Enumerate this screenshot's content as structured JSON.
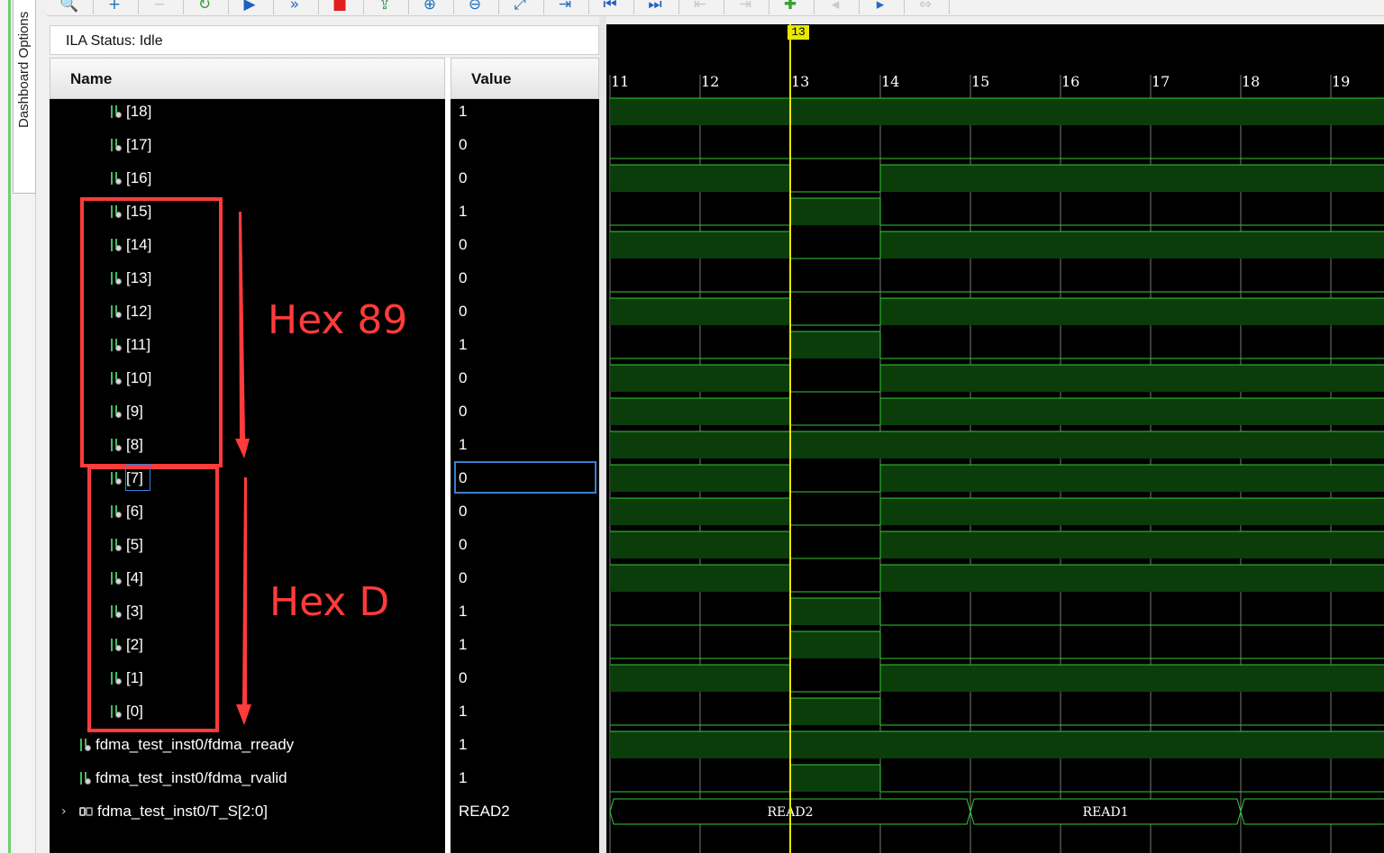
{
  "dashboard": {
    "tab_label": "Dashboard Options"
  },
  "toolbar": {
    "buttons": [
      {
        "name": "zoom-icon",
        "glyph": "🔍",
        "color": "#1f6fbf"
      },
      {
        "name": "add-probe-icon",
        "glyph": "+",
        "color": "#1f6fbf"
      },
      {
        "name": "remove-probe-icon",
        "glyph": "−",
        "color": "#c9c9c9"
      },
      {
        "name": "auto-trigger-icon",
        "glyph": "↻",
        "color": "#2fa32f"
      },
      {
        "name": "run-trigger-icon",
        "glyph": "▶",
        "color": "#1f5fbf"
      },
      {
        "name": "trigger-immediate-icon",
        "glyph": "»",
        "color": "#1f5fbf"
      },
      {
        "name": "stop-trigger-icon",
        "glyph": "■",
        "color": "#e02020"
      },
      {
        "name": "export-icon",
        "glyph": "⇪",
        "color": "#2f8f4f"
      },
      {
        "name": "zoom-in-icon",
        "glyph": "⊕",
        "color": "#1f6fbf"
      },
      {
        "name": "zoom-out-icon",
        "glyph": "⊖",
        "color": "#1f6fbf"
      },
      {
        "name": "zoom-fit-icon",
        "glyph": "⤢",
        "color": "#1f6fbf"
      },
      {
        "name": "goto-cursor-icon",
        "glyph": "⇥",
        "color": "#1f6fbf"
      },
      {
        "name": "goto-start-icon",
        "glyph": "⏮",
        "color": "#1f5fbf"
      },
      {
        "name": "goto-end-icon",
        "glyph": "⏭",
        "color": "#1f5fbf"
      },
      {
        "name": "prev-transition-icon",
        "glyph": "⇤",
        "color": "#c9c9c9"
      },
      {
        "name": "next-transition-icon",
        "glyph": "⇥",
        "color": "#c9c9c9"
      },
      {
        "name": "add-marker-icon",
        "glyph": "✚",
        "color": "#2fa32f"
      },
      {
        "name": "prev-marker-icon",
        "glyph": "◂",
        "color": "#c9c9c9"
      },
      {
        "name": "next-marker-icon",
        "glyph": "▸",
        "color": "#1f6fbf"
      },
      {
        "name": "swap-cursors-icon",
        "glyph": "⇔",
        "color": "#c9c9c9"
      }
    ]
  },
  "status": {
    "text": "ILA Status:  Idle"
  },
  "columns": {
    "name": "Name",
    "value": "Value"
  },
  "signals": [
    {
      "label": "[18]",
      "value": "1",
      "kind": "bit",
      "wave": [
        1,
        1,
        1,
        1,
        1,
        1,
        1,
        1,
        1
      ]
    },
    {
      "label": "[17]",
      "value": "0",
      "kind": "bit",
      "wave": [
        0,
        0,
        0,
        0,
        0,
        0,
        0,
        0,
        0
      ]
    },
    {
      "label": "[16]",
      "value": "0",
      "kind": "bit",
      "wave": [
        1,
        1,
        0,
        1,
        1,
        1,
        1,
        1,
        1
      ]
    },
    {
      "label": "[15]",
      "value": "1",
      "kind": "bit",
      "wave": [
        0,
        0,
        1,
        0,
        0,
        0,
        0,
        0,
        0
      ]
    },
    {
      "label": "[14]",
      "value": "0",
      "kind": "bit",
      "wave": [
        1,
        1,
        0,
        1,
        1,
        1,
        1,
        1,
        1
      ]
    },
    {
      "label": "[13]",
      "value": "0",
      "kind": "bit",
      "wave": [
        0,
        0,
        0,
        0,
        0,
        0,
        0,
        0,
        0
      ]
    },
    {
      "label": "[12]",
      "value": "0",
      "kind": "bit",
      "wave": [
        1,
        1,
        0,
        1,
        1,
        1,
        1,
        1,
        1
      ]
    },
    {
      "label": "[11]",
      "value": "1",
      "kind": "bit",
      "wave": [
        0,
        0,
        1,
        0,
        0,
        0,
        0,
        0,
        0
      ]
    },
    {
      "label": "[10]",
      "value": "0",
      "kind": "bit",
      "wave": [
        1,
        1,
        0,
        1,
        1,
        1,
        1,
        1,
        1
      ]
    },
    {
      "label": "[9]",
      "value": "0",
      "kind": "bit",
      "wave": [
        1,
        1,
        0,
        1,
        1,
        1,
        1,
        1,
        1
      ]
    },
    {
      "label": "[8]",
      "value": "1",
      "kind": "bit",
      "wave": [
        1,
        1,
        1,
        1,
        1,
        1,
        1,
        1,
        1
      ]
    },
    {
      "label": "[7]",
      "value": "0",
      "kind": "bit",
      "wave": [
        1,
        1,
        0,
        1,
        1,
        1,
        1,
        1,
        1
      ],
      "selected": true
    },
    {
      "label": "[6]",
      "value": "0",
      "kind": "bit",
      "wave": [
        1,
        1,
        0,
        1,
        1,
        1,
        1,
        1,
        1
      ]
    },
    {
      "label": "[5]",
      "value": "0",
      "kind": "bit",
      "wave": [
        1,
        1,
        0,
        1,
        1,
        1,
        1,
        1,
        1
      ]
    },
    {
      "label": "[4]",
      "value": "0",
      "kind": "bit",
      "wave": [
        1,
        1,
        0,
        1,
        1,
        1,
        1,
        1,
        1
      ]
    },
    {
      "label": "[3]",
      "value": "1",
      "kind": "bit",
      "wave": [
        0,
        0,
        1,
        0,
        0,
        0,
        0,
        0,
        0
      ]
    },
    {
      "label": "[2]",
      "value": "1",
      "kind": "bit",
      "wave": [
        0,
        0,
        1,
        0,
        0,
        0,
        0,
        0,
        0
      ]
    },
    {
      "label": "[1]",
      "value": "0",
      "kind": "bit",
      "wave": [
        1,
        1,
        0,
        1,
        1,
        1,
        1,
        1,
        1
      ]
    },
    {
      "label": "[0]",
      "value": "1",
      "kind": "bit",
      "wave": [
        0,
        0,
        1,
        0,
        0,
        0,
        0,
        0,
        0
      ]
    },
    {
      "label": "fdma_test_inst0/fdma_rready",
      "value": "1",
      "kind": "top",
      "wave": [
        1,
        1,
        1,
        1,
        1,
        1,
        1,
        1,
        1
      ]
    },
    {
      "label": "fdma_test_inst0/fdma_rvalid",
      "value": "1",
      "kind": "top",
      "wave": [
        0,
        0,
        1,
        0,
        0,
        0,
        0,
        0,
        0
      ]
    },
    {
      "label": "fdma_test_inst0/T_S[2:0]",
      "value": "READ2",
      "kind": "bus",
      "bus": [
        {
          "from": 11,
          "to": 15,
          "text": "READ2"
        },
        {
          "from": 15,
          "to": 18,
          "text": "READ1"
        },
        {
          "from": 18,
          "to": 20,
          "text": ""
        }
      ]
    }
  ],
  "timeline": {
    "ticks": [
      "11",
      "12",
      "13",
      "14",
      "15",
      "16",
      "17",
      "18",
      "19"
    ],
    "start": 11,
    "cursor": 13,
    "cursor_label": "13"
  },
  "annotations": [
    {
      "text": "Hex 89"
    },
    {
      "text": "Hex D"
    }
  ],
  "colors": {
    "wave_high": "#0b3d0b",
    "wave_line": "#36c936",
    "grid": "#7a7a7a",
    "cursor": "#e8e800",
    "annotation": "#ff3b3b"
  }
}
